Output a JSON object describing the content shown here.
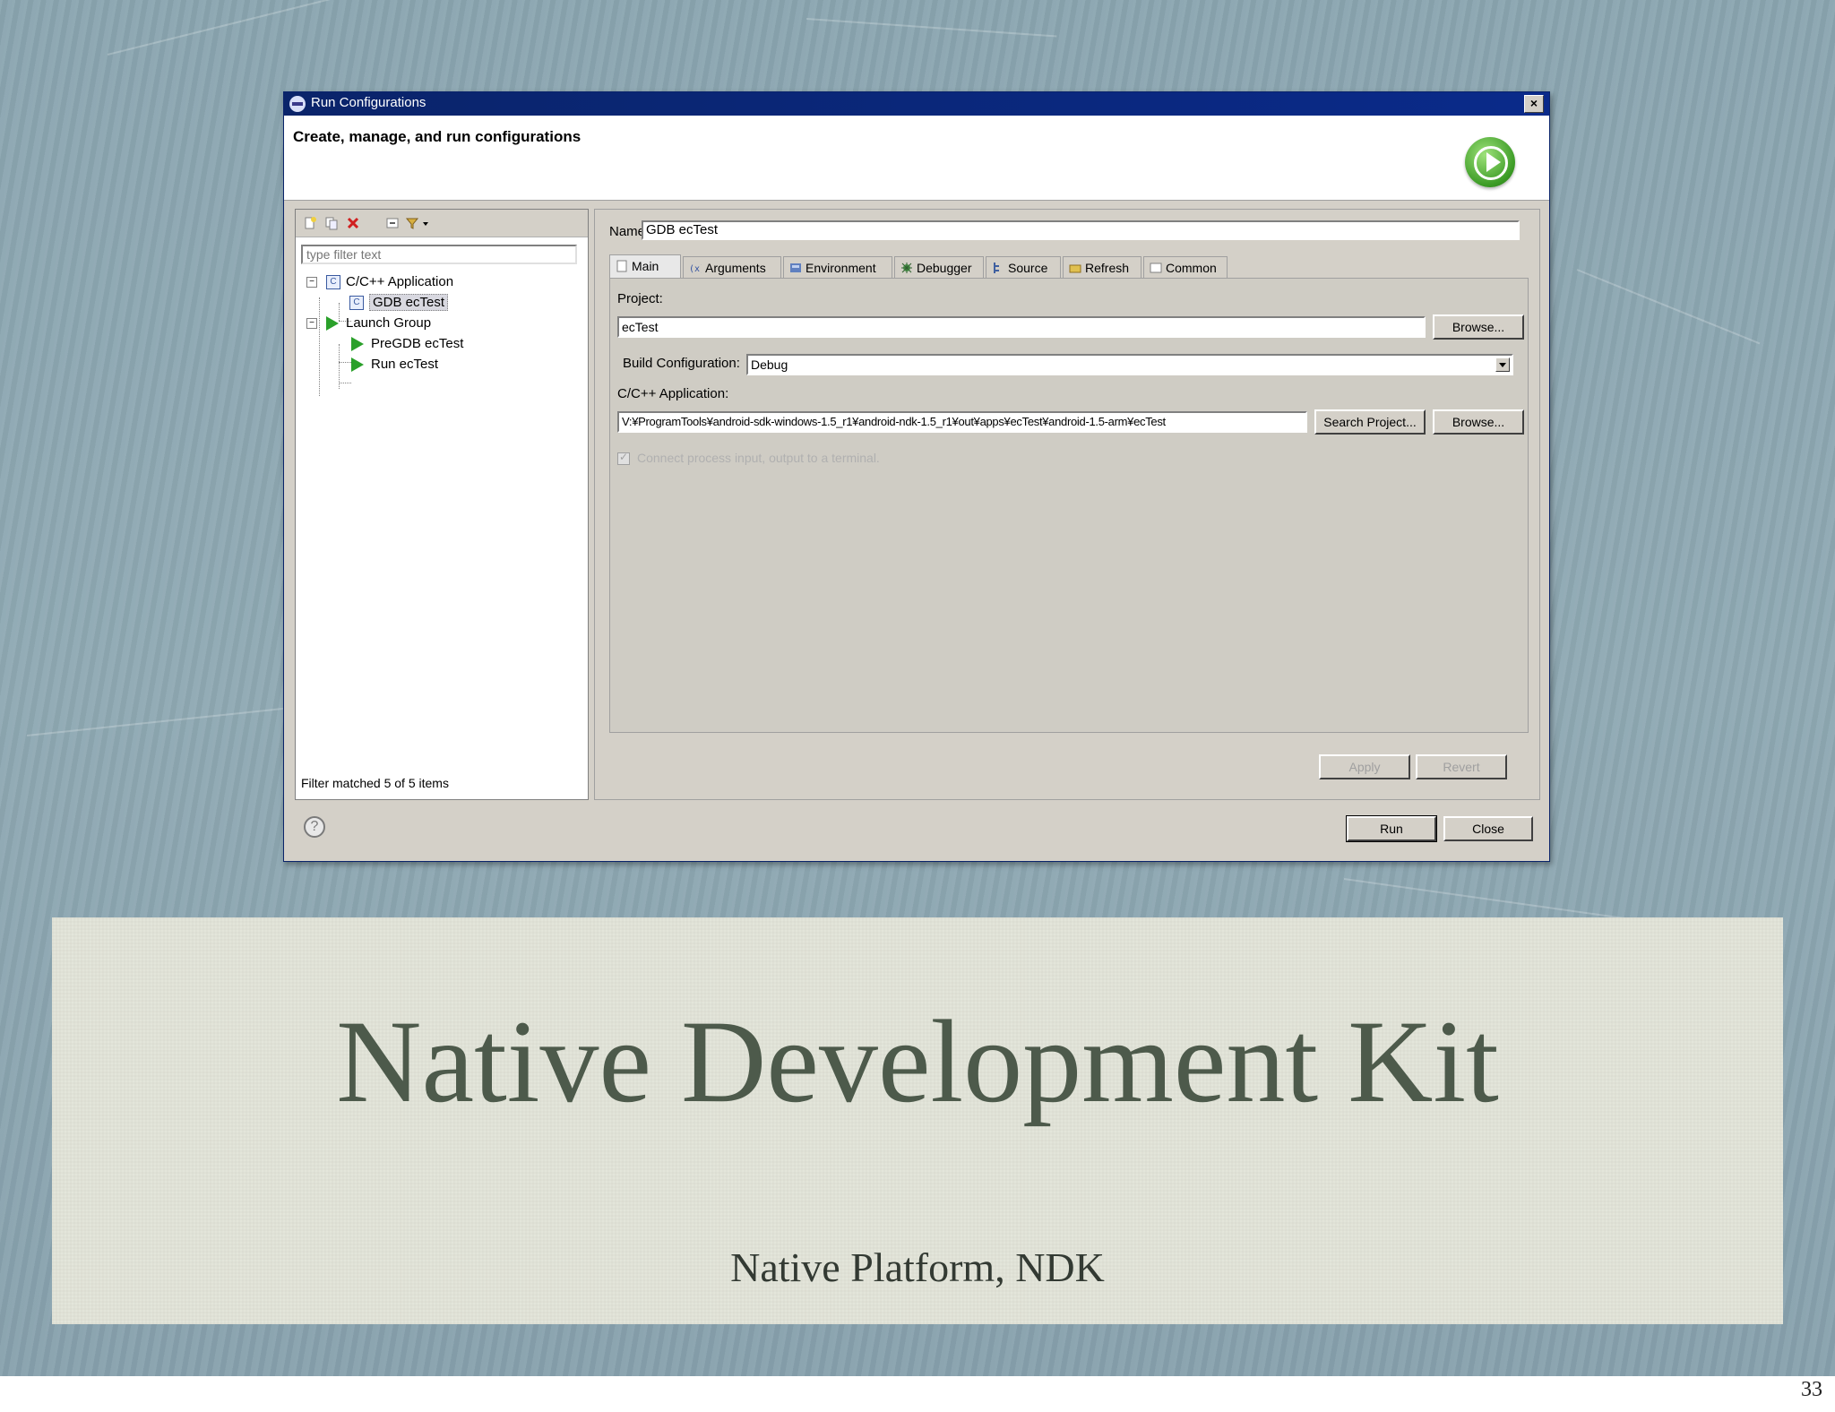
{
  "slide": {
    "title": "Native Development Kit",
    "subtitle": "Native Platform, NDK",
    "page_number": "33"
  },
  "dialog": {
    "window_title": "Run Configurations",
    "close_glyph": "×",
    "header_text": "Create, manage, and run configurations",
    "filter_placeholder": "type filter text",
    "tree": {
      "cpp_application": "C/C++ Application",
      "gdb_ectest": "GDB ecTest",
      "launch_group": "Launch Group",
      "pregdb_ectest": "PreGDB ecTest",
      "run_ectest": "Run ecTest"
    },
    "filter_status": "Filter matched 5 of 5 items",
    "name_label": "Name:",
    "name_value": "GDB ecTest",
    "tabs": [
      "Main",
      "Arguments",
      "Environment",
      "Debugger",
      "Source",
      "Refresh",
      "Common"
    ],
    "project_label": "Project:",
    "project_value": "ecTest",
    "browse_label": "Browse...",
    "build_config_label": "Build Configuration:",
    "build_config_value": "Debug",
    "cpp_app_label": "C/C++ Application:",
    "cpp_app_value": "V:¥ProgramTools¥android-sdk-windows-1.5_r1¥android-ndk-1.5_r1¥out¥apps¥ecTest¥android-1.5-arm¥ecTest",
    "search_project_label": "Search Project...",
    "terminal_label": "Connect process input, output to a terminal.",
    "apply_label": "Apply",
    "revert_label": "Revert",
    "run_label": "Run",
    "close_label": "Close",
    "help_glyph": "?"
  },
  "colors": {
    "titlebar": "#0a246a",
    "dialog_bg": "#d4d0c8",
    "slide_bg": "#8aa5b0",
    "title_box": "#e2e4d8",
    "title_text": "#4d5a4b",
    "run_icon": "#3a9a24"
  },
  "icons": {
    "toolbar": [
      "new-config-icon",
      "duplicate-icon",
      "delete-icon",
      "collapse-all-icon",
      "filter-icon",
      "dropdown-icon"
    ],
    "tabs": [
      "main-tab-icon",
      "arguments-tab-icon",
      "environment-tab-icon",
      "debugger-tab-icon",
      "source-tab-icon",
      "refresh-tab-icon",
      "common-tab-icon"
    ]
  }
}
